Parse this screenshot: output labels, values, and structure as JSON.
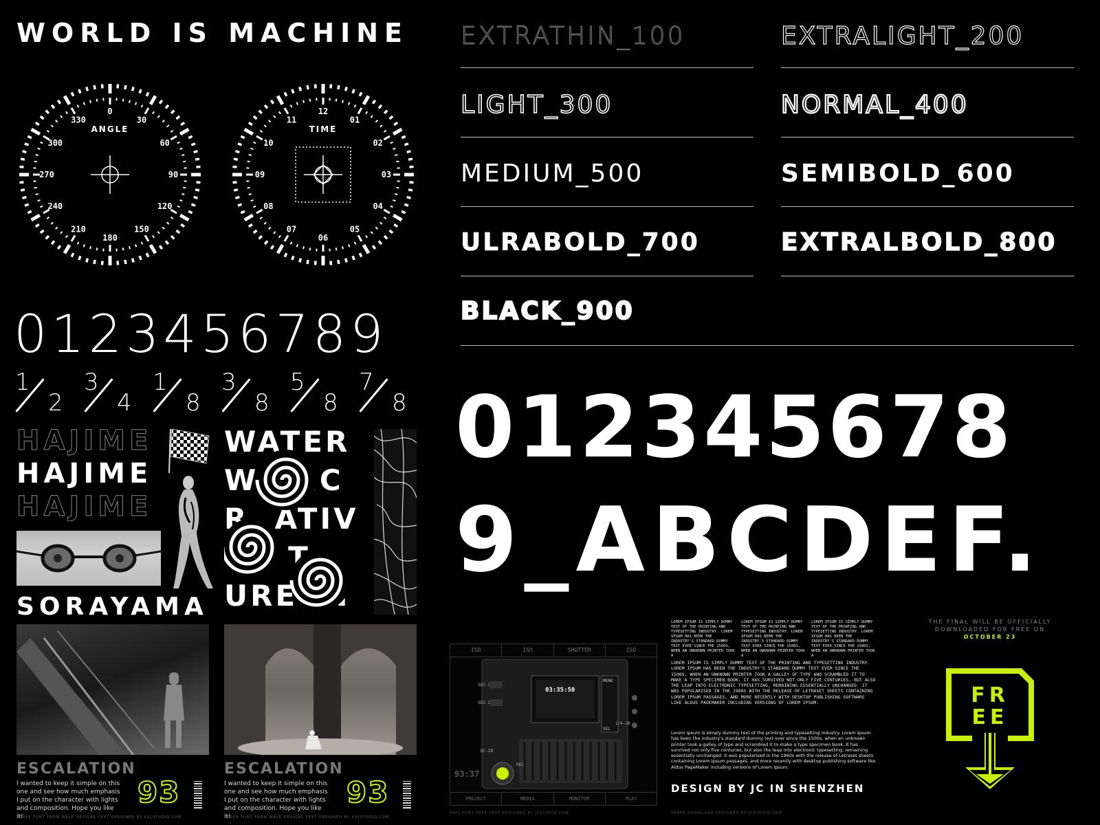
{
  "title": "WORLD IS MACHINE",
  "dials": {
    "angle": {
      "label": "ANGLE",
      "ticks": [
        "0",
        "30",
        "60",
        "90",
        "120",
        "150",
        "180",
        "210",
        "240",
        "270",
        "300",
        "330"
      ]
    },
    "time": {
      "label": "TIME",
      "ticks": [
        "12",
        "01",
        "02",
        "03",
        "04",
        "05",
        "06",
        "07",
        "08",
        "09",
        "10",
        "11"
      ]
    }
  },
  "digits_row": "0123456789",
  "fractions": [
    {
      "num": "1",
      "den": "2"
    },
    {
      "num": "3",
      "den": "4"
    },
    {
      "num": "1",
      "den": "8"
    },
    {
      "num": "3",
      "den": "8"
    },
    {
      "num": "5",
      "den": "8"
    },
    {
      "num": "7",
      "den": "8"
    }
  ],
  "weights": [
    "EXTRATHIN_100",
    "EXTRALIGHT_200",
    "LIGHT_300",
    "NORMAL_400",
    "MEDIUM_500",
    "SEMIBOLD_600",
    "ULRABOLD_700",
    "EXTRALBOLD_800",
    "BLACK_900"
  ],
  "big_numbers": "012345678",
  "big_letters": "9_ABCDEF.",
  "collage": {
    "hajime": "HAJIME",
    "sorayama": "SORAYAMA",
    "water_lines": [
      "WATER",
      "W   EC",
      "R  ATIV",
      "     T",
      "URE  N"
    ]
  },
  "cards": [
    {
      "title": "ESCALATION",
      "text": "I wanted to keep it simple on this one and see how much emphasis I put on the character with lights and composition. Hope you like it!",
      "number": "93",
      "footer": "THREE FONT FROM WAVE DESIGNS TEXT DESIGNED BY XXLSTUDIO.COM"
    },
    {
      "title": "ESCALATION",
      "text": "I wanted to keep it simple on this one and see how much emphasis I put on the character with lights and composition. Hope you like it!",
      "number": "93",
      "footer": "THREE FONT FROM WAVE DESIGNS TEXT DESIGNED BY XXLSTUDIO.COM"
    }
  ],
  "device": {
    "top_labels": [
      "ISO",
      "ISO",
      "SHUTTER",
      "ISO"
    ],
    "bottom_labels": [
      "PROJECT",
      "MEDIA",
      "MONITOR",
      "PLAY"
    ],
    "screen_time": "03:35:50",
    "screen_buttons": [
      "MENU",
      "SEL"
    ],
    "side_labels": [
      "SDI-1",
      "SDI-2",
      "DC-IN",
      "REC",
      "1/4-20"
    ],
    "timecode": "93:37",
    "caption": "THIS FONT FREE TEXT DESIGNED BY JCSTUDIO.COM"
  },
  "lorem_small": [
    "LOREM IPSUM IS SIMPLY DUMMY TEXT OF THE PRINTING AND TYPESETTING INDUSTRY. LOREM IPSUM HAS BEEN THE INDUSTRY'S STANDARD DUMMY TEXT EVER SINCE THE 1500S, WHEN AN UNKNOWN PRINTER TOOK A",
    "LOREM IPSUM IS SIMPLY DUMMY TEXT OF THE PRINTING AND TYPESETTING INDUSTRY. LOREM IPSUM HAS BEEN THE INDUSTRY'S STANDARD DUMMY TEXT EVER SINCE THE 1500S, WHEN AN UNKNOWN PRINTER TOOK A",
    "LOREM IPSUM IS SIMPLY DUMMY TEXT OF THE PRINTING AND TYPESETTING INDUSTRY. LOREM IPSUM HAS BEEN THE INDUSTRY'S STANDARD DUMMY TEXT EVER SINCE THE 1500S, WHEN AN UNKNOWN PRINTER TOOK A"
  ],
  "lorem_upper": "LOREM IPSUM IS SIMPLY DUMMY TEXT OF THE PRINTING AND TYPESETTING INDUSTRY. LOREM IPSUM HAS BEEN THE INDUSTRY'S STANDARD DUMMY TEXT EVER SINCE THE 1500S, WHEN AN UNKNOWN PRINTER TOOK A GALLEY OF TYPE AND SCRAMBLED IT TO MAKE A TYPE SPECIMEN BOOK. IT HAS SURVIVED NOT ONLY FIVE CENTURIES, BUT ALSO THE LEAP INTO ELECTRONIC TYPESETTING, REMAINING ESSENTIALLY UNCHANGED. IT WAS POPULARISED IN THE 1960S WITH THE RELEASE OF LETRASET SHEETS CONTAINING LOREM IPSUM PASSAGES, AND MORE RECENTLY WITH DESKTOP PUBLISHING SOFTWARE LIKE ALDUS PAGEMAKER INCLUDING VERSIONS OF LOREM IPSUM.",
  "lorem_lower": "Lorem Ipsum is simply dummy text of the printing and typesetting industry. Lorem Ipsum has been the industry's standard dummy text ever since the 1500s, when an unknown printer took a galley of type and scrambled it to make a type specimen book. It has survived not only five centuries, but also the leap into electronic typesetting, remaining essentially unchanged. It was popularised in the 1960s with the release of Letraset sheets containing Lorem Ipsum passages, and more recently with desktop publishing software like Aldus PageMaker including versions of Lorem Ipsum.",
  "credit": "DESIGN BY JC IN SHENZHEN",
  "credit_small": "THREE DOWNLOAD DESIGNED BY JCSTUDIO.COM",
  "release": {
    "line1": "THE FINAL WILL BE OFFICIALLY",
    "line2": "DOWNLOADED FOR FREE ON",
    "date": "OCTOBER 23",
    "badge": "FREE"
  },
  "colors": {
    "accent": "#c8f000",
    "bg": "#000000",
    "fg": "#ffffff",
    "rule": "#bdbdbd"
  }
}
